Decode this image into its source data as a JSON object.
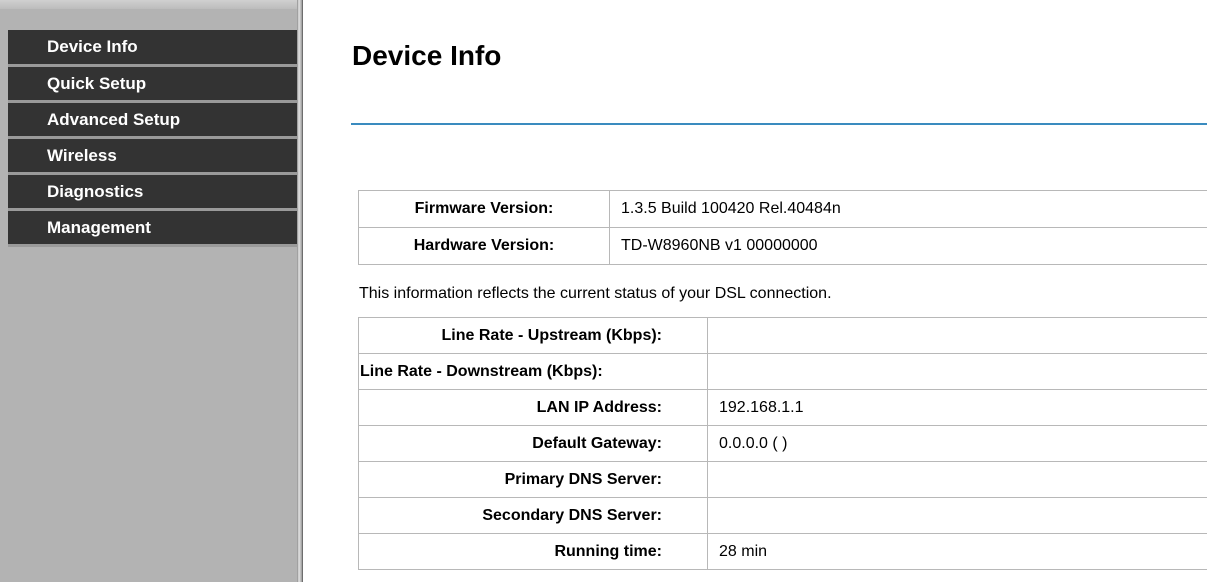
{
  "sidebar": {
    "items": [
      {
        "label": "Device Info"
      },
      {
        "label": "Quick Setup"
      },
      {
        "label": "Advanced Setup"
      },
      {
        "label": "Wireless"
      },
      {
        "label": "Diagnostics"
      },
      {
        "label": "Management"
      }
    ]
  },
  "main": {
    "title": "Device Info",
    "versions": [
      {
        "label": "Firmware Version:",
        "value": "1.3.5 Build 100420 Rel.40484n"
      },
      {
        "label": "Hardware Version:",
        "value": "TD-W8960NB v1 00000000"
      }
    ],
    "info_text": "This information reflects the current status of your DSL connection.",
    "status": [
      {
        "label": "Line Rate - Upstream (Kbps):",
        "value": ""
      },
      {
        "label": "Line Rate - Downstream (Kbps):",
        "value": ""
      },
      {
        "label": "LAN IP Address:",
        "value": "192.168.1.1"
      },
      {
        "label": "Default Gateway:",
        "value": "0.0.0.0 ( )"
      },
      {
        "label": "Primary DNS Server:",
        "value": ""
      },
      {
        "label": "Secondary DNS Server:",
        "value": ""
      },
      {
        "label": "Running time:",
        "value": "28 min"
      }
    ]
  },
  "colors": {
    "menu_bg": "#333333",
    "sidebar_bg": "#b3b3b3",
    "title_rule": "#3a8bbf"
  }
}
